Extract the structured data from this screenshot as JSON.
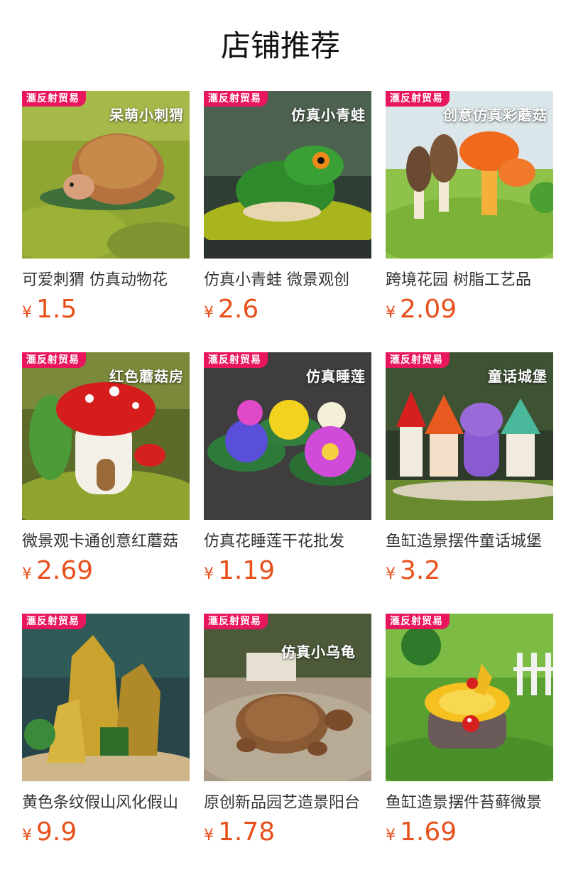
{
  "page": {
    "title": "店铺推荐"
  },
  "products": [
    {
      "seller": "滙反射贸易",
      "overlay": "呆萌小刺猬",
      "name": "可爱刺猬 仿真动物花",
      "currency": "¥",
      "price": "1.5"
    },
    {
      "seller": "滙反射贸易",
      "overlay": "仿真小青蛙",
      "name": "仿真小青蛙 微景观创",
      "currency": "¥",
      "price": "2.6"
    },
    {
      "seller": "滙反射贸易",
      "overlay": "创意仿真彩蘑菇",
      "name": "跨境花园 树脂工艺品",
      "currency": "¥",
      "price": "2.09"
    },
    {
      "seller": "滙反射贸易",
      "overlay": "红色蘑菇房",
      "name": "微景观卡通创意红蘑菇",
      "currency": "¥",
      "price": "2.69"
    },
    {
      "seller": "滙反射贸易",
      "overlay": "仿真睡莲",
      "name": "仿真花睡莲干花批发",
      "currency": "¥",
      "price": "1.19"
    },
    {
      "seller": "滙反射贸易",
      "overlay": "童话城堡",
      "name": "鱼缸造景摆件童话城堡",
      "currency": "¥",
      "price": "3.2"
    },
    {
      "seller": "滙反射贸易",
      "overlay": "",
      "name": "黄色条纹假山风化假山",
      "currency": "¥",
      "price": "9.9"
    },
    {
      "seller": "滙反射贸易",
      "overlay": "仿真小乌龟",
      "name": "原创新品园艺造景阳台",
      "currency": "¥",
      "price": "1.78"
    },
    {
      "seller": "滙反射贸易",
      "overlay": "",
      "name": "鱼缸造景摆件苔藓微景",
      "currency": "¥",
      "price": "1.69"
    }
  ]
}
